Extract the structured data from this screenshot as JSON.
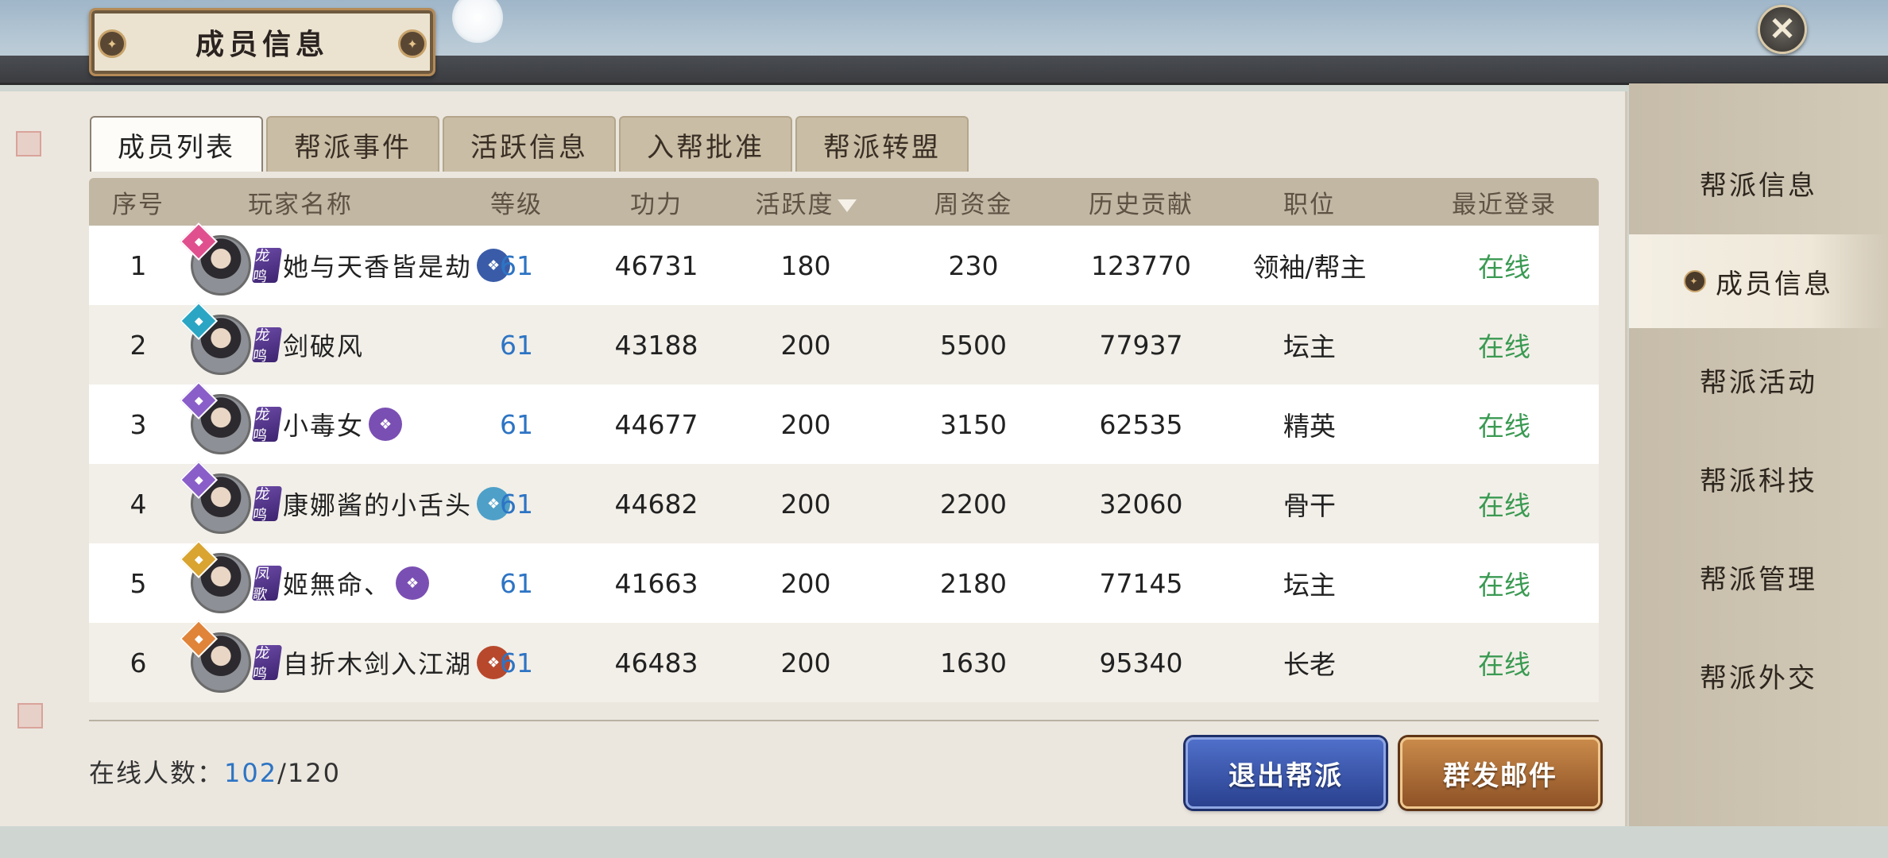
{
  "window": {
    "title": "成员信息",
    "close_icon": "close-icon"
  },
  "tabs": [
    {
      "label": "成员列表",
      "active": true
    },
    {
      "label": "帮派事件",
      "active": false
    },
    {
      "label": "活跃信息",
      "active": false
    },
    {
      "label": "入帮批准",
      "active": false
    },
    {
      "label": "帮派转盟",
      "active": false
    }
  ],
  "table": {
    "headers": [
      "序号",
      "玩家名称",
      "等级",
      "功力",
      "活跃度",
      "周资金",
      "历史贡献",
      "职位",
      "最近登录"
    ],
    "rows": [
      {
        "index": "1",
        "name": "她与天香皆是劫",
        "tier": "龙鸣",
        "level": "61",
        "power": "46731",
        "activity": "180",
        "weekly": "230",
        "contribution": "123770",
        "position": "领袖/帮主",
        "login": "在线",
        "sect_color": "#e0508f",
        "title_color": "#3a5ca8"
      },
      {
        "index": "2",
        "name": "剑破风",
        "tier": "龙鸣",
        "level": "61",
        "power": "43188",
        "activity": "200",
        "weekly": "5500",
        "contribution": "77937",
        "position": "坛主",
        "login": "在线",
        "sect_color": "#2aa6c4",
        "title_color": ""
      },
      {
        "index": "3",
        "name": "小毒女",
        "tier": "龙鸣",
        "level": "61",
        "power": "44677",
        "activity": "200",
        "weekly": "3150",
        "contribution": "62535",
        "position": "精英",
        "login": "在线",
        "sect_color": "#8a5ec9",
        "title_color": "#7a4fb3"
      },
      {
        "index": "4",
        "name": "康娜酱的小舌头",
        "tier": "龙鸣",
        "level": "61",
        "power": "44682",
        "activity": "200",
        "weekly": "2200",
        "contribution": "32060",
        "position": "骨干",
        "login": "在线",
        "sect_color": "#8a5ec9",
        "title_color": "#4ea0c8"
      },
      {
        "index": "5",
        "name": "姬無命、",
        "tier": "凤歌",
        "level": "61",
        "power": "41663",
        "activity": "200",
        "weekly": "2180",
        "contribution": "77145",
        "position": "坛主",
        "login": "在线",
        "sect_color": "#d9a430",
        "title_color": "#7a4fb3"
      },
      {
        "index": "6",
        "name": "自折木剑入江湖",
        "tier": "龙鸣",
        "level": "61",
        "power": "46483",
        "activity": "200",
        "weekly": "1630",
        "contribution": "95340",
        "position": "长老",
        "login": "在线",
        "sect_color": "#e0843a",
        "title_color": "#b8482c"
      }
    ]
  },
  "footer": {
    "online_label": "在线人数：",
    "online_current": "102",
    "online_total": "/120",
    "quit_button": "退出帮派",
    "mail_button": "群发邮件"
  },
  "sidenav": [
    {
      "label": "帮派信息",
      "active": false
    },
    {
      "label": "成员信息",
      "active": true
    },
    {
      "label": "帮派活动",
      "active": false
    },
    {
      "label": "帮派科技",
      "active": false
    },
    {
      "label": "帮派管理",
      "active": false
    },
    {
      "label": "帮派外交",
      "active": false
    }
  ],
  "colors": {
    "level": "#2d74c4",
    "online": "#3a9a52",
    "quit_button": "#3a55a8",
    "mail_button": "#a86a34"
  }
}
